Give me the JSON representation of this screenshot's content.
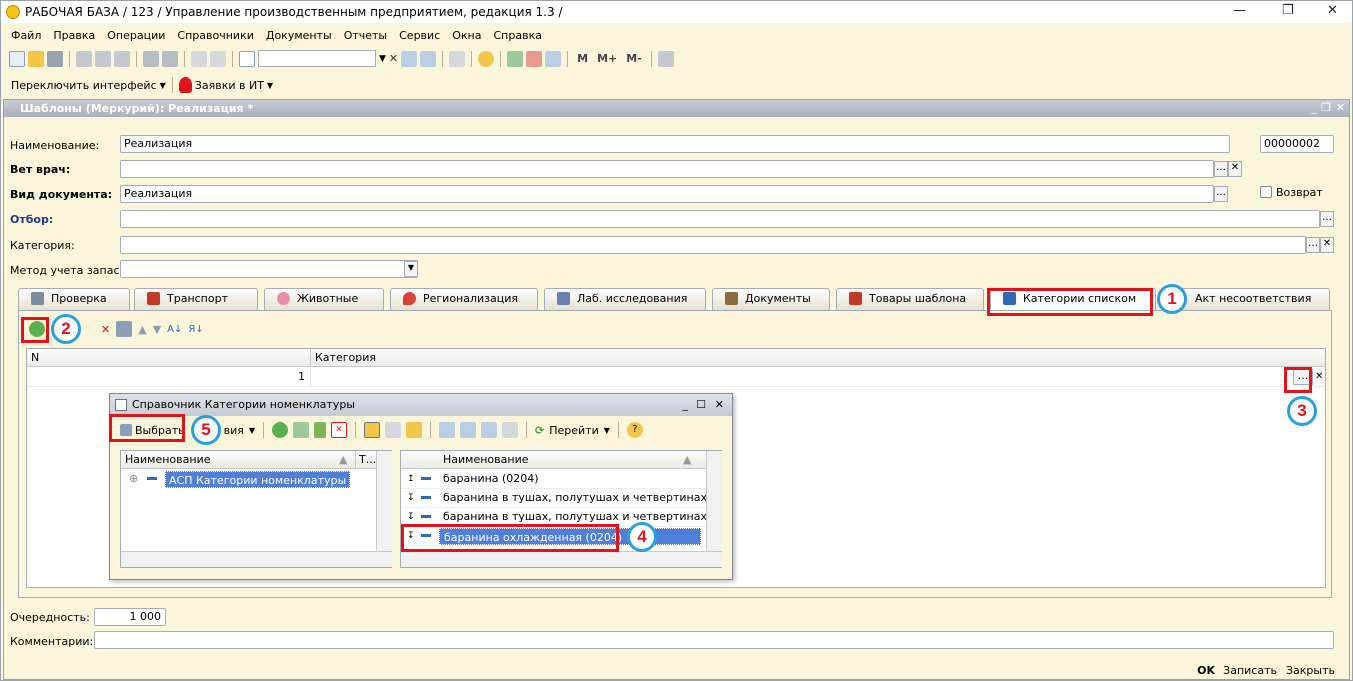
{
  "app": {
    "title": "РАБОЧАЯ БАЗА / 123 /  Управление производственным предприятием, редакция 1.3 /",
    "menu": [
      "Файл",
      "Правка",
      "Операции",
      "Справочники",
      "Документы",
      "Отчеты",
      "Сервис",
      "Окна",
      "Справка"
    ],
    "switch_interface": "Переключить интерфейс",
    "it_requests": "Заявки в ИТ",
    "toolbar_letters": [
      "M",
      "M+",
      "M-"
    ]
  },
  "document": {
    "title": "Шаблоны (Меркурий): Реализация *",
    "fields": {
      "name_label": "Наименование:",
      "name_value": "Реализация",
      "code_value": "00000002",
      "vet_label": "Вет врач:",
      "vet_value": "",
      "doctype_label": "Вид документа:",
      "doctype_value": "Реализация",
      "return_label": "Возврат",
      "filter_label": "Отбор:",
      "filter_value": "",
      "category_label": "Категория:",
      "category_value": "",
      "method_label": "Метод учета запасов:",
      "method_value": ""
    },
    "tabs": [
      {
        "label": "Проверка",
        "color": "#7b8c9a"
      },
      {
        "label": "Транспорт",
        "color": "#c0392b"
      },
      {
        "label": "Животные",
        "color": "#e58fa8"
      },
      {
        "label": "Регионализация",
        "color": "#d9443a"
      },
      {
        "label": "Лаб. исследования",
        "color": "#6a7fb0"
      },
      {
        "label": "Документы",
        "color": "#8b6a3e"
      },
      {
        "label": "Товары шаблона",
        "color": "#c0392b"
      },
      {
        "label": "Категории списком",
        "color": "#2d6bb5"
      },
      {
        "label": "Акт несоответствия",
        "color": "#7b8c9a"
      }
    ],
    "grid": {
      "columns": [
        "N",
        "Категория"
      ],
      "rows": [
        {
          "n": "1",
          "category": ""
        }
      ]
    },
    "order_label": "Очередность:",
    "order_value": "1 000",
    "comments_label": "Комментарии:",
    "comments_value": "",
    "footer_buttons": [
      "OK",
      "Записать",
      "Закрыть"
    ]
  },
  "dialog": {
    "title": "Справочник Категории номенклатуры",
    "select_label": "Выбрать",
    "actions_label": "вия",
    "goto_label": "Перейти",
    "left_header": "Наименование",
    "left_header2": "Т...",
    "left_rows": [
      "АСП Категории номенклатуры"
    ],
    "right_header": "Наименование",
    "right_rows": [
      "баранина (0204)",
      "баранина в тушах, полутушах и четвертинах мор...",
      "баранина в тушах, полутушах и четвертинах охл...",
      "баранина охлажденная (0204)"
    ]
  },
  "annotations": [
    "1",
    "2",
    "3",
    "4",
    "5"
  ]
}
